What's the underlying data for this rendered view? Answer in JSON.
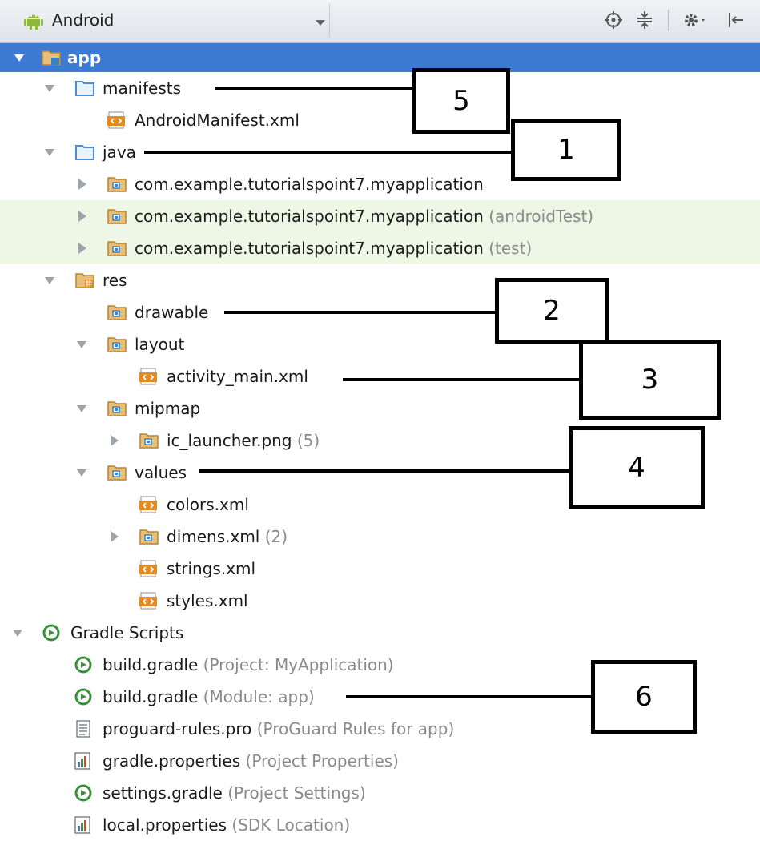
{
  "toolbar": {
    "view_selector": "Android",
    "icons": [
      "android-icon",
      "chevron-down-icon",
      "locate-icon",
      "collapse-all-icon",
      "gear-icon",
      "hide-icon"
    ]
  },
  "tree": {
    "app": "app",
    "manifests": "manifests",
    "android_manifest": "AndroidManifest.xml",
    "java": "java",
    "pkg_main": "com.example.tutorialspoint7.myapplication",
    "pkg_android_test": "com.example.tutorialspoint7.myapplication",
    "pkg_android_test_suffix": "(androidTest)",
    "pkg_test": "com.example.tutorialspoint7.myapplication",
    "pkg_test_suffix": "(test)",
    "res": "res",
    "drawable": "drawable",
    "layout": "layout",
    "activity_main": "activity_main.xml",
    "mipmap": "mipmap",
    "ic_launcher": "ic_launcher.png",
    "ic_launcher_suffix": "(5)",
    "values": "values",
    "colors": "colors.xml",
    "dimens": "dimens.xml",
    "dimens_suffix": "(2)",
    "strings": "strings.xml",
    "styles": "styles.xml",
    "gradle_scripts": "Gradle Scripts",
    "build_gradle_project": "build.gradle",
    "build_gradle_project_suffix": "(Project: MyApplication)",
    "build_gradle_module": "build.gradle",
    "build_gradle_module_suffix": "(Module: app)",
    "proguard": "proguard-rules.pro",
    "proguard_suffix": "(ProGuard Rules for app)",
    "gradle_properties": "gradle.properties",
    "gradle_properties_suffix": "(Project Properties)",
    "settings_gradle": "settings.gradle",
    "settings_gradle_suffix": "(Project Settings)",
    "local_properties": "local.properties",
    "local_properties_suffix": "(SDK Location)"
  },
  "annotations": {
    "manifests": "5",
    "java": "1",
    "drawable": "2",
    "layout": "3",
    "values": "4",
    "build_gradle_module": "6"
  },
  "colors": {
    "selection": "#3d7ad4",
    "test_tint": "#eef7e6",
    "folder_yellow": "#d9a441",
    "folder_blue": "#4a8fd4",
    "gradle_green": "#3a8f3a"
  }
}
